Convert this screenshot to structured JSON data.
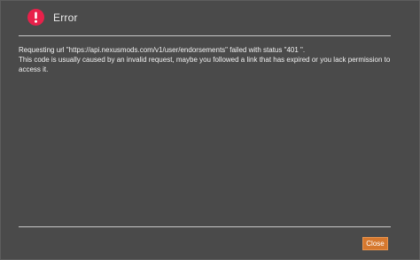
{
  "dialog": {
    "title": "Error",
    "icon": "error-circle-icon",
    "message_line1": "Requesting url \"https://api.nexusmods.com/v1/user/endorsements\" failed with status \"401 \".",
    "message_line2": "This code is usually caused by an invalid request, maybe you followed a link that has expired or you lack permission to access it.",
    "close_label": "Close"
  },
  "colors": {
    "background": "#4a4a4a",
    "error_icon": "#e8214a",
    "button": "#d6782e",
    "divider": "#c8c8c8",
    "text": "#f2f2f2"
  }
}
